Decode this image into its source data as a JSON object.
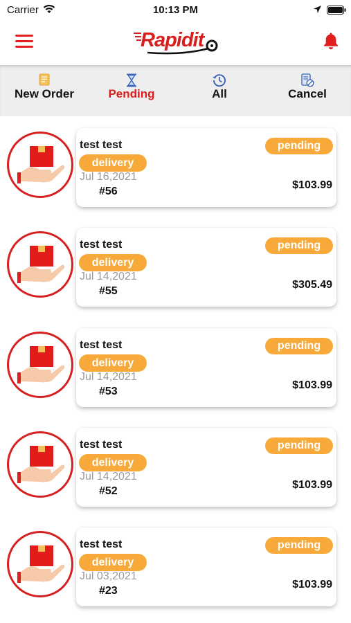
{
  "status_bar": {
    "carrier": "Carrier",
    "time": "10:13 PM"
  },
  "header": {
    "logo_text": "Rapidit",
    "logo_color": "#d81f1f"
  },
  "tabs": [
    {
      "label": "New Order",
      "icon": "document-icon",
      "active": false
    },
    {
      "label": "Pending",
      "icon": "hourglass-icon",
      "active": true
    },
    {
      "label": "All",
      "icon": "history-clock-icon",
      "active": false
    },
    {
      "label": "Cancel",
      "icon": "cancel-document-icon",
      "active": false
    }
  ],
  "orders": [
    {
      "name": "test test",
      "type": "delivery",
      "date": "Jul 16,2021",
      "number": "#56",
      "status": "pending",
      "price": "$103.99"
    },
    {
      "name": "test test",
      "type": "delivery",
      "date": "Jul 14,2021",
      "number": "#55",
      "status": "pending",
      "price": "$305.49"
    },
    {
      "name": "test test",
      "type": "delivery",
      "date": "Jul 14,2021",
      "number": "#53",
      "status": "pending",
      "price": "$103.99"
    },
    {
      "name": "test test",
      "type": "delivery",
      "date": "Jul 14,2021",
      "number": "#52",
      "status": "pending",
      "price": "$103.99"
    },
    {
      "name": "test test",
      "type": "delivery",
      "date": "Jul 03,2021",
      "number": "#23",
      "status": "pending",
      "price": "$103.99"
    }
  ],
  "colors": {
    "accent": "#d81f1f",
    "badge": "#f7a93a",
    "tab_bar": "#eeeeee"
  }
}
